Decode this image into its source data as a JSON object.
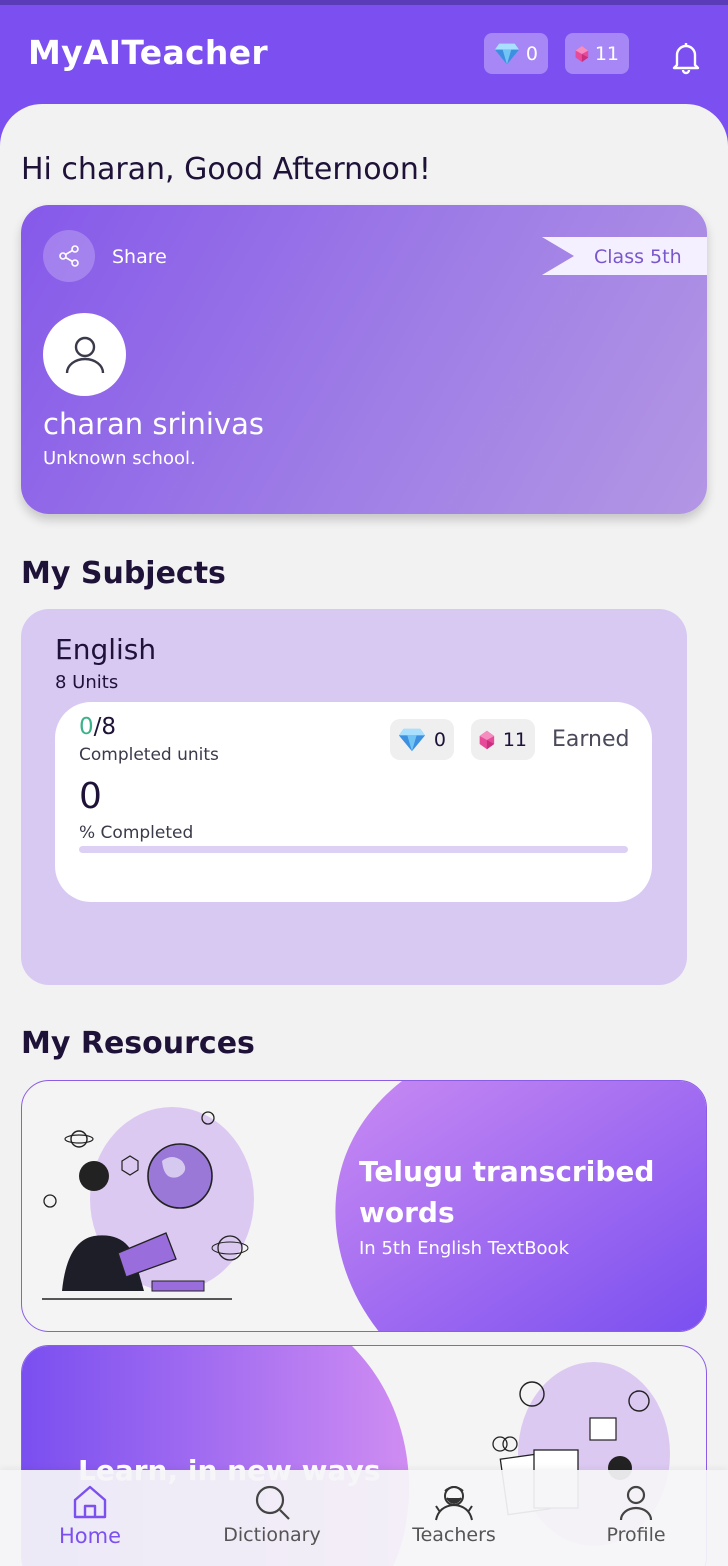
{
  "app": {
    "title": "MyAITeacher",
    "diamond_count": "0",
    "gem_count": "11"
  },
  "greeting": "Hi charan, Good Afternoon!",
  "profile": {
    "share_label": "Share",
    "class_label": "Class 5th",
    "name": "charan srinivas",
    "school": "Unknown school."
  },
  "sections": {
    "subjects": "My Subjects",
    "resources": "My Resources"
  },
  "subject": {
    "name": "English",
    "units": "8 Units",
    "completed_units": "0",
    "total_units": "/8",
    "completed_units_label": "Completed units",
    "percent": "0",
    "percent_label": "% Completed",
    "progress_fraction": 0,
    "diamonds": "0",
    "gems": "11",
    "earned_label": "Earned"
  },
  "resources": [
    {
      "title": "Telugu transcribed words",
      "subtitle": "In 5th English TextBook"
    },
    {
      "title": "Learn, in new ways"
    }
  ],
  "nav": [
    {
      "label": "Home",
      "icon": "home-icon"
    },
    {
      "label": "Dictionary",
      "icon": "search-icon"
    },
    {
      "label": "Teachers",
      "icon": "teacher-icon"
    },
    {
      "label": "Profile",
      "icon": "profile-icon"
    }
  ],
  "colors": {
    "primary": "#7c4ff0",
    "accent_light": "#d8c9f3",
    "completed_green": "#3bb38a"
  }
}
